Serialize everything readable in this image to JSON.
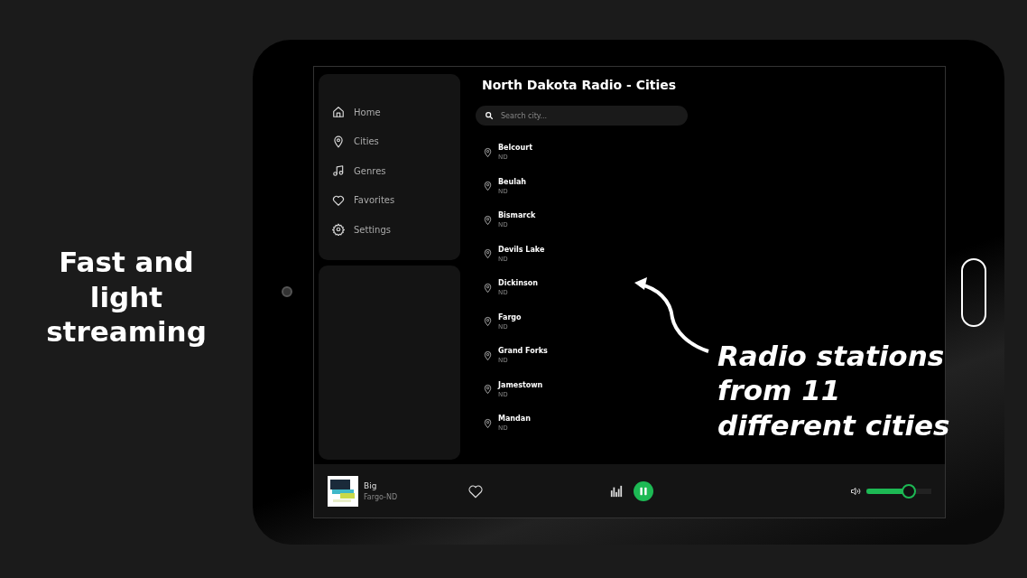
{
  "promo": {
    "headline": "Fast and light streaming",
    "callout": "Radio stations from 11 different cities"
  },
  "sidebar": {
    "items": [
      {
        "label": "Home",
        "kind": "home"
      },
      {
        "label": "Cities",
        "kind": "pin"
      },
      {
        "label": "Genres",
        "kind": "music"
      },
      {
        "label": "Favorites",
        "kind": "heart"
      },
      {
        "label": "Settings",
        "kind": "gear"
      }
    ]
  },
  "page": {
    "title": "North Dakota Radio - Cities",
    "search": {
      "placeholder": "Search city..."
    }
  },
  "cities": [
    {
      "name": "Belcourt",
      "state": "ND"
    },
    {
      "name": "Beulah",
      "state": "ND"
    },
    {
      "name": "Bismarck",
      "state": "ND"
    },
    {
      "name": "Devils Lake",
      "state": "ND"
    },
    {
      "name": "Dickinson",
      "state": "ND"
    },
    {
      "name": "Fargo",
      "state": "ND"
    },
    {
      "name": "Grand Forks",
      "state": "ND"
    },
    {
      "name": "Jamestown",
      "state": "ND"
    },
    {
      "name": "Mandan",
      "state": "ND"
    }
  ],
  "player": {
    "station": "Big",
    "location": "Fargo-ND",
    "favorite": false,
    "playing": true,
    "volume": {
      "level": 0.65
    }
  }
}
